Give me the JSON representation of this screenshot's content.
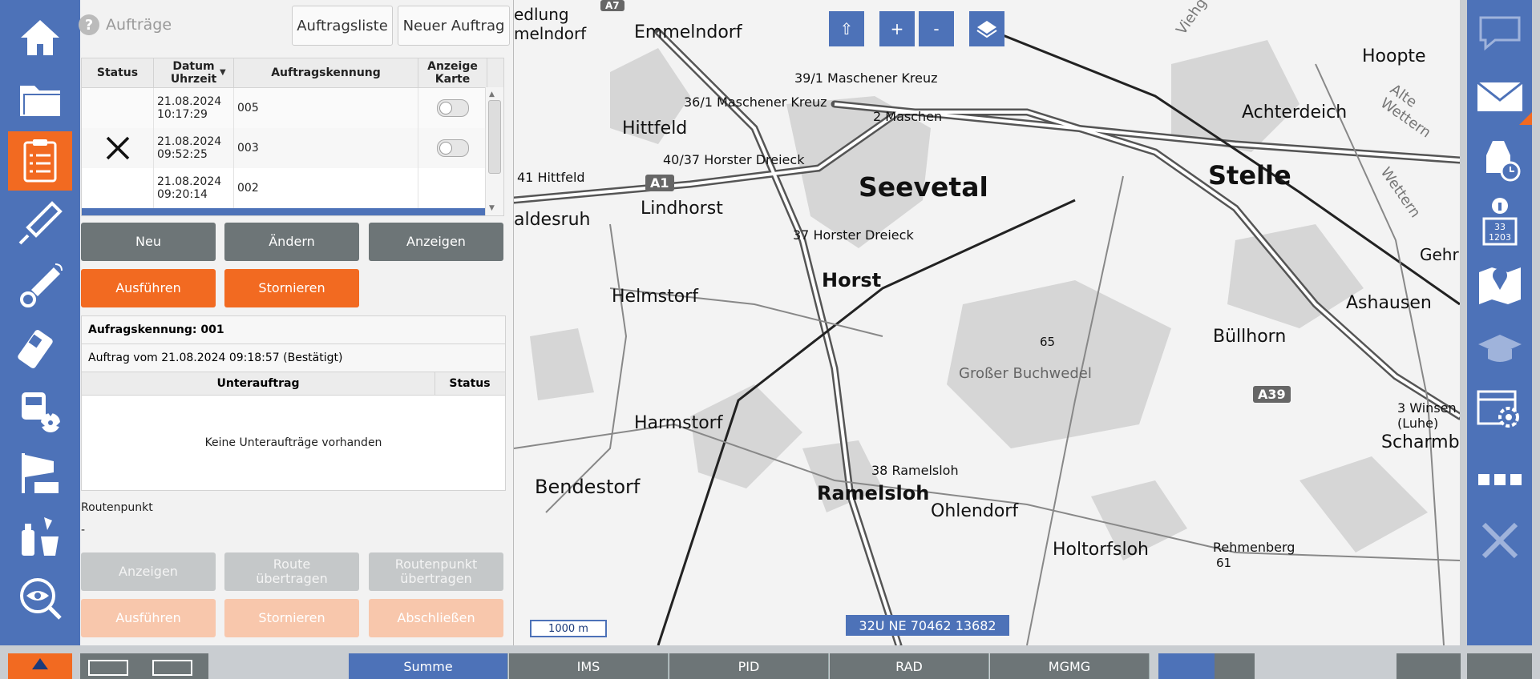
{
  "header": {
    "title": "Aufträge",
    "tab_list": "Auftragsliste",
    "tab_new": "Neuer Auftrag"
  },
  "table": {
    "columns": [
      "Status",
      "Datum\nUhrzeit",
      "Auftragskennung",
      "Anzeige\nKarte"
    ],
    "col_status": "Status",
    "col_date_1": "Datum",
    "col_date_2": "Uhrzeit",
    "col_id": "Auftragskennung",
    "col_map_1": "Anzeige",
    "col_map_2": "Karte",
    "rows": [
      {
        "date": "21.08.2024",
        "time": "10:17:29",
        "id": "005",
        "status": "",
        "toggle": false
      },
      {
        "date": "21.08.2024",
        "time": "09:52:25",
        "id": "003",
        "status": "cancelled",
        "toggle": false
      },
      {
        "date": "21.08.2024",
        "time": "09:20:14",
        "id": "002",
        "status": "",
        "toggle": null
      }
    ]
  },
  "actions": {
    "new": "Neu",
    "edit": "Ändern",
    "show": "Anzeigen",
    "execute": "Ausführen",
    "cancel": "Stornieren"
  },
  "detail": {
    "id_line": "Aufragskennung: 001",
    "order_line": "Auftrag vom 21.08.2024 09:18:57 (Bestätigt)",
    "col_sub": "Unterauftrag",
    "col_status": "Status",
    "empty": "Keine Unteraufträge vorhanden",
    "route_label": "Routenpunkt",
    "route_value": "-"
  },
  "route_actions": {
    "show": "Anzeigen",
    "transfer_route": "Route\nübertragen",
    "transfer_route_1": "Route",
    "transfer_route_2": "übertragen",
    "transfer_point_1": "Routenpunkt",
    "transfer_point_2": "übertragen",
    "execute": "Ausführen",
    "cancel": "Stornieren",
    "finish": "Abschließen"
  },
  "map": {
    "btn_up": "⇧",
    "btn_plus": "+",
    "btn_minus": "-",
    "scale": "1000 m",
    "coords": "32U NE 70462 13682",
    "labels": [
      "Emmelndorf",
      "Hittfeld",
      "Seevetal",
      "Stelle",
      "Achterdeich",
      "Hoopte",
      "Lindhorst",
      "Horst",
      "Helmstorf",
      "Harmstorf",
      "Bendestorf",
      "Ramelsloh",
      "Ohlendorf",
      "Holtorfsloh",
      "Großer Buchwedel",
      "Büllhorn",
      "Ashausen",
      "Scharmb",
      "Rehmenberg",
      "61",
      "65",
      "A1",
      "A39",
      "A7",
      "39/1 Maschener Kreuz",
      "36/1 Maschener Kreuz",
      "2 Maschen",
      "40/37 Horster Dreieck",
      "41 Hittfeld",
      "37 Horster Dreieck",
      "38 Ramelsloh",
      "3 Winsen (Luhe)",
      "aldesruh",
      "edlung",
      "melndorf",
      "Gehr",
      "Alte Wettern",
      "Wettern",
      "Viehg"
    ]
  },
  "bottom_tabs": [
    "Summe",
    "IMS",
    "PID",
    "RAD",
    "MGMG"
  ]
}
